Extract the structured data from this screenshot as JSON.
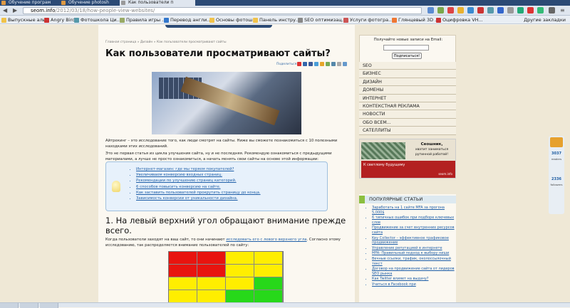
{
  "browser": {
    "tabs": [
      {
        "label": "Обучение програм"
      },
      {
        "label": "Обучение photosh"
      },
      {
        "label": "Как пользователи п"
      }
    ],
    "url_host": "seom.info",
    "url_path": "/2012/03/18/how-people-view-websites/",
    "bookmarks": [
      {
        "label": "Выпускные аль..."
      },
      {
        "label": "Angry Birds"
      },
      {
        "label": "Фотошкола Ци..."
      },
      {
        "label": "Правила игры ..."
      },
      {
        "label": "Перевод англи..."
      },
      {
        "label": "Основы фотош..."
      },
      {
        "label": "Панель инстру..."
      },
      {
        "label": "SEO оптимизац..."
      },
      {
        "label": "Услуги фотогра..."
      },
      {
        "label": "Глянцевый 3D ..."
      },
      {
        "label": "Оцифровка VH..."
      }
    ],
    "other_bookmarks": "Другие закладки"
  },
  "article": {
    "breadcrumb": "Главная страница » Дизайн » Как пользователи просматривают сайты",
    "title": "Как пользователи просматривают сайты?",
    "share_label": "Поделиться:",
    "intro": "Айтрекинг – это исследование того, как люди смотрят на сайты. Ниже вы сможете познакомиться с 10 полезными находками этих исследований.",
    "para2": "Это не первая статья из цикла улучшения сайта, ну и не последняя. Рекомендую ознакомиться с предыдущими материалами, а лучше не просто ознакомиться, а начать менять свои сайты на основе этой информации:",
    "toc": [
      {
        "label": "Интернет-магазин: где мы теряем покупателей?"
      },
      {
        "label": "Увеличиваем конверсию входных страниц."
      },
      {
        "label": "Рекомендации по улучшению страниц категорий."
      },
      {
        "label": "6 способов повысить конверсию на сайте."
      },
      {
        "label": "Как заставить пользователей прокрутить страницу до конца."
      },
      {
        "label": "Зависимость конверсии от уникальности дизайна."
      }
    ],
    "h2": "1. На левый верхний угол обращают внимание прежде всего.",
    "para3_a": "Когда пользователи заходят на ваш сайт, то они начинают ",
    "para3_link": "исследовать его с левого верхнего угла",
    "para3_b": ". Согласно этому исследованию, так распределяется внимание пользователей по сайту:"
  },
  "heatmap_colors": {
    "red": "#e8140f",
    "yellow": "#ffee00",
    "green": "#27d81a"
  },
  "sidebar": {
    "subscribe_label": "Получайте новые записи на Email:",
    "subscribe_button": "Подписаться!",
    "menu": [
      {
        "label": "SEO"
      },
      {
        "label": "БИЗНЕС"
      },
      {
        "label": "ДИЗАЙН"
      },
      {
        "label": "ДОМЕНЫ"
      },
      {
        "label": "ИНТЕРНЕТ"
      },
      {
        "label": "КОНТЕКСТНАЯ РЕКЛАМА"
      },
      {
        "label": "НОВОСТИ"
      },
      {
        "label": "ОБО ВСЕМ..."
      },
      {
        "label": "САТЕЛЛИТЫ"
      }
    ],
    "banner_title": "Сеошник,",
    "banner_sub": "хватит заниматься рутинной работой!",
    "banner_red": "К светлому будущему",
    "banner_site": "seom.info",
    "popular_title": "ПОПУЛЯРНЫЕ СТАТЬИ",
    "popular": [
      {
        "label": "Заработать на 1 сайте МFA за прогона 5,000$"
      },
      {
        "label": "6 типичных ошибок при подборе ключевых слов"
      },
      {
        "label": "Продвижение за счет внутренних ресурсов сайта"
      },
      {
        "label": "Key Collector – эффективное трафиковое продвижение"
      },
      {
        "label": "Управление репутацией в интернете"
      },
      {
        "label": "MFA: Правильный подход к выбору ниши"
      },
      {
        "label": "Вечные ссылки, трафик, околоссылочный текст"
      },
      {
        "label": "Договор на продвижение сайта от лидеров SEO рынка"
      },
      {
        "label": "Как Twitter влияет на выдачу?"
      },
      {
        "label": "Учиться в Facebook при"
      }
    ]
  },
  "widget": {
    "readers": "3037",
    "readers_label": "readers",
    "followers": "2336",
    "followers_label": "followers"
  }
}
